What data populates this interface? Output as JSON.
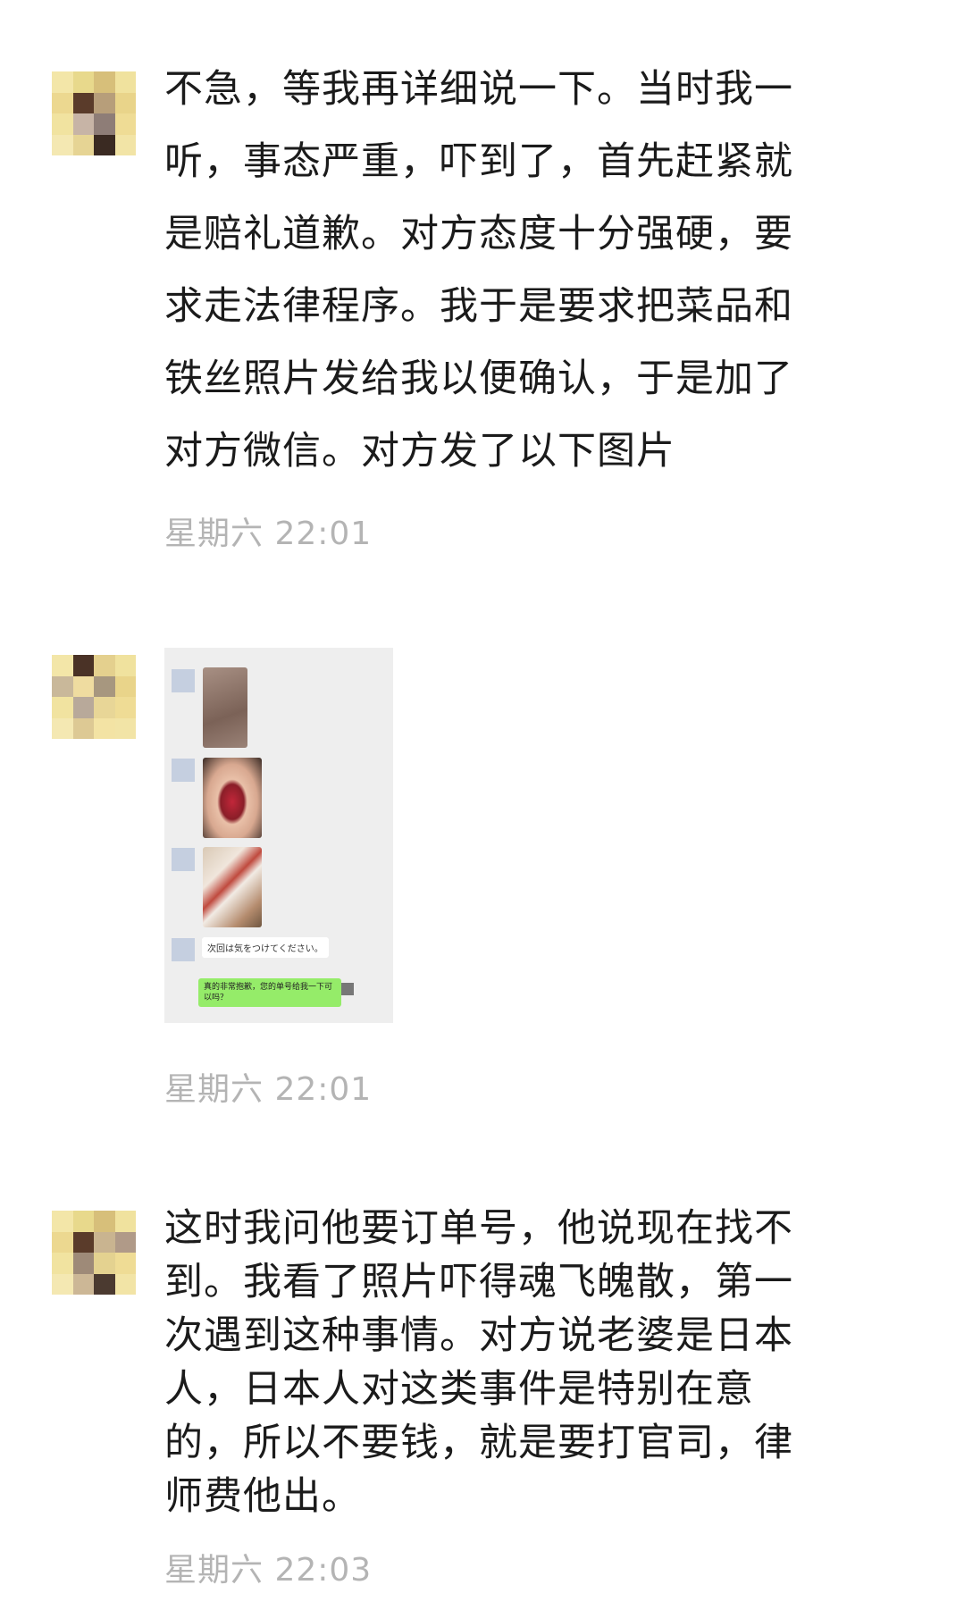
{
  "messages": [
    {
      "text": "不急，等我再详细说一下。当时我一听，事态严重，吓到了，首先赶紧就是赔礼道歉。对方态度十分强硬，要求走法律程序。我于是要求把菜品和铁丝照片发给我以便确认，于是加了对方微信。对方发了以下图片",
      "time": "星期六 22:01"
    },
    {
      "screenshot": {
        "reply_jp": "次回は気をつけてください。",
        "reply_cn": "真的非常抱歉，您的单号给我一下可以吗？"
      },
      "time": "星期六 22:01"
    },
    {
      "text": "这时我问他要订单号，他说现在找不到。我看了照片吓得魂飞魄散，第一次遇到这种事情。对方说老婆是日本人，日本人对这类事件是特别在意的，所以不要钱，就是要打官司，律师费他出。",
      "time": "星期六 22:03"
    }
  ],
  "colors": {
    "timestamp": "#b4b4b4",
    "green_bubble": "#95ec69",
    "text": "#1b1b1b"
  }
}
